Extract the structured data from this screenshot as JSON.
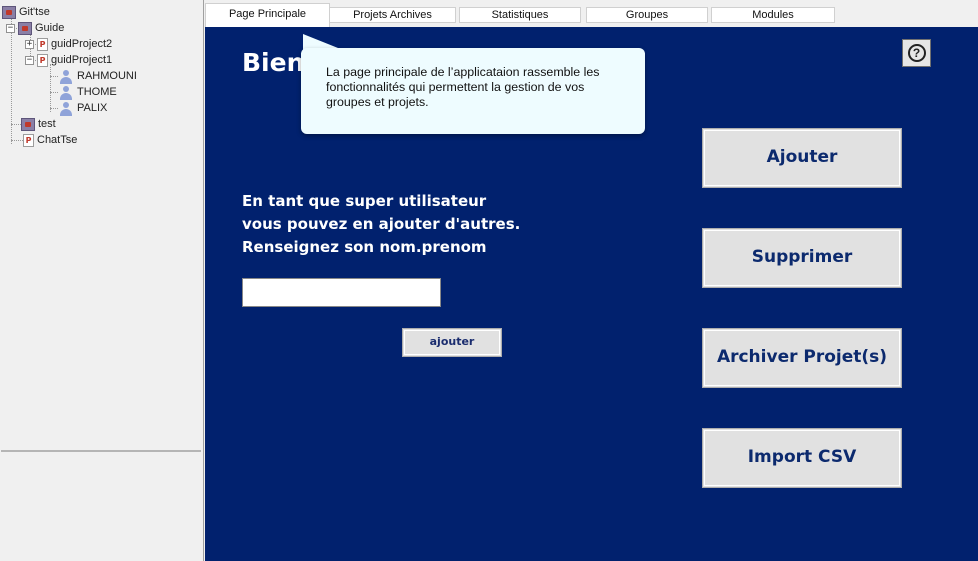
{
  "tree": {
    "root_label": "Git'tse",
    "items": [
      {
        "label": "Guide"
      },
      {
        "label": "guidProject2"
      },
      {
        "label": "guidProject1"
      },
      {
        "label": "RAHMOUNI"
      },
      {
        "label": "THOME"
      },
      {
        "label": "PALIX"
      },
      {
        "label": "test"
      },
      {
        "label": "ChatTse"
      }
    ]
  },
  "tabs": [
    {
      "label": "Page Principale"
    },
    {
      "label": "Projets Archives"
    },
    {
      "label": "Statistiques"
    },
    {
      "label": "Groupes"
    },
    {
      "label": "Modules"
    }
  ],
  "main": {
    "welcome_title": "Bienv",
    "tooltip_text": "La page principale de l’applicataion rassemble les fonctionnalités qui permettent la gestion de vos groupes et projets.",
    "help_symbol": "?",
    "super_user_lines": [
      "En tant que super utilisateur",
      "vous pouvez en ajouter d'autres.",
      "Renseignez son nom.prenom"
    ],
    "name_input_value": "",
    "add_small_label": "ajouter",
    "buttons": [
      {
        "label": "Ajouter"
      },
      {
        "label": "Supprimer"
      },
      {
        "label": "Archiver Projet(s)"
      },
      {
        "label": "Import CSV"
      }
    ]
  },
  "colors": {
    "main_background": "#01216e",
    "tooltip_background": "#eefcff",
    "button_text": "#0c2a6e"
  }
}
